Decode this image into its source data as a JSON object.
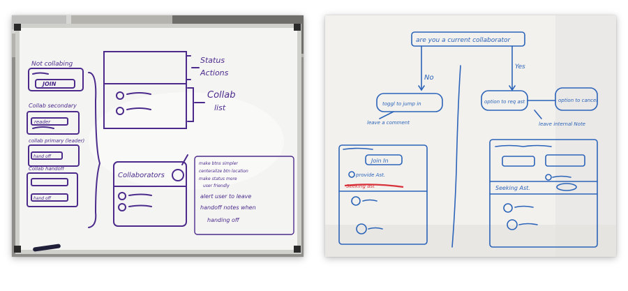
{
  "left_photo": {
    "alt": "Whiteboard sketch of collaboration panel states in purple marker",
    "colors": {
      "ink": "#4b2a8c",
      "frame": "#c9c9c6",
      "board": "#f4f4f2"
    },
    "labels": {
      "not_collabing": "Not collabing",
      "join": "JOIN",
      "collab_secondary": "Collab secondary",
      "reader": "reader",
      "collab_primary": "collab primary (leader)",
      "hand_off": "hand off",
      "collab_handoff": "Collab handoff",
      "hand_off_2": "hand off",
      "status": "Status",
      "actions": "Actions",
      "collab_list_1": "Collab",
      "collab_list_2": "list",
      "collaborators": "Collaborators",
      "note_1": "make btns simpler",
      "note_2": "centeralize btn location",
      "note_3": "make status more",
      "note_4": "user friendly",
      "note_5": "alert user to leave",
      "note_6": "handoff notes when",
      "note_7": "handing off"
    }
  },
  "right_photo": {
    "alt": "Whiteboard flowchart of collaborator decision in blue marker",
    "colors": {
      "ink": "#2b63b8",
      "red": "#d8333a",
      "board": "#f2f1ee"
    },
    "labels": {
      "question": "are you a current collaborator",
      "no": "No",
      "yes": "Yes",
      "toggle": "toggl to jump in",
      "leave_comment": "leave a comment",
      "option_req": "option to req ast",
      "option_cancel": "option to cancel",
      "leave_internal": "leave internal Note",
      "join_in": "Join In",
      "provide_ast": "provide Ast.",
      "seeking_ast_red": "Seeking ast",
      "seeking_ast": "Seeking Ast."
    }
  }
}
